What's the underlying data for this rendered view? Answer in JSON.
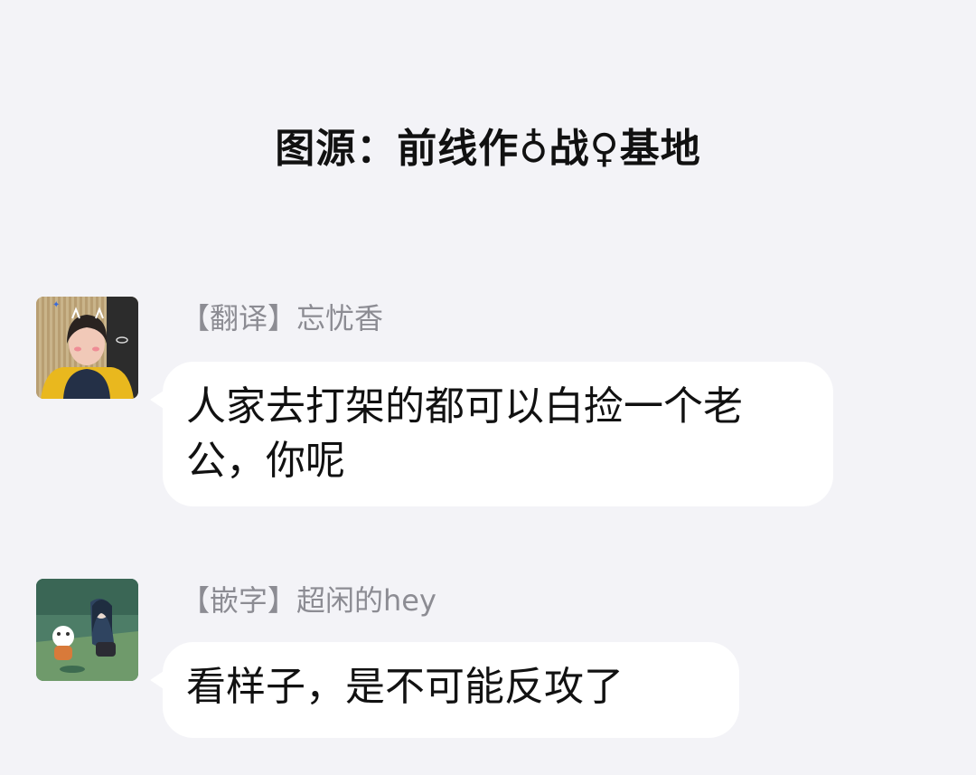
{
  "caption": "图源：前线作♁战♀基地",
  "messages": [
    {
      "sender": "【翻译】忘忧香",
      "text": "人家去打架的都可以白捡一个老公，你呢",
      "avatar_icon": "person-photo-avatar"
    },
    {
      "sender": "【嵌字】超闲的hey",
      "text": "看样子，是不可能反攻了",
      "avatar_icon": "anime-illustration-avatar"
    }
  ],
  "colors": {
    "background": "#f3f3f7",
    "bubble": "#ffffff",
    "sender_text": "#8c8c93",
    "message_text": "#111111"
  }
}
